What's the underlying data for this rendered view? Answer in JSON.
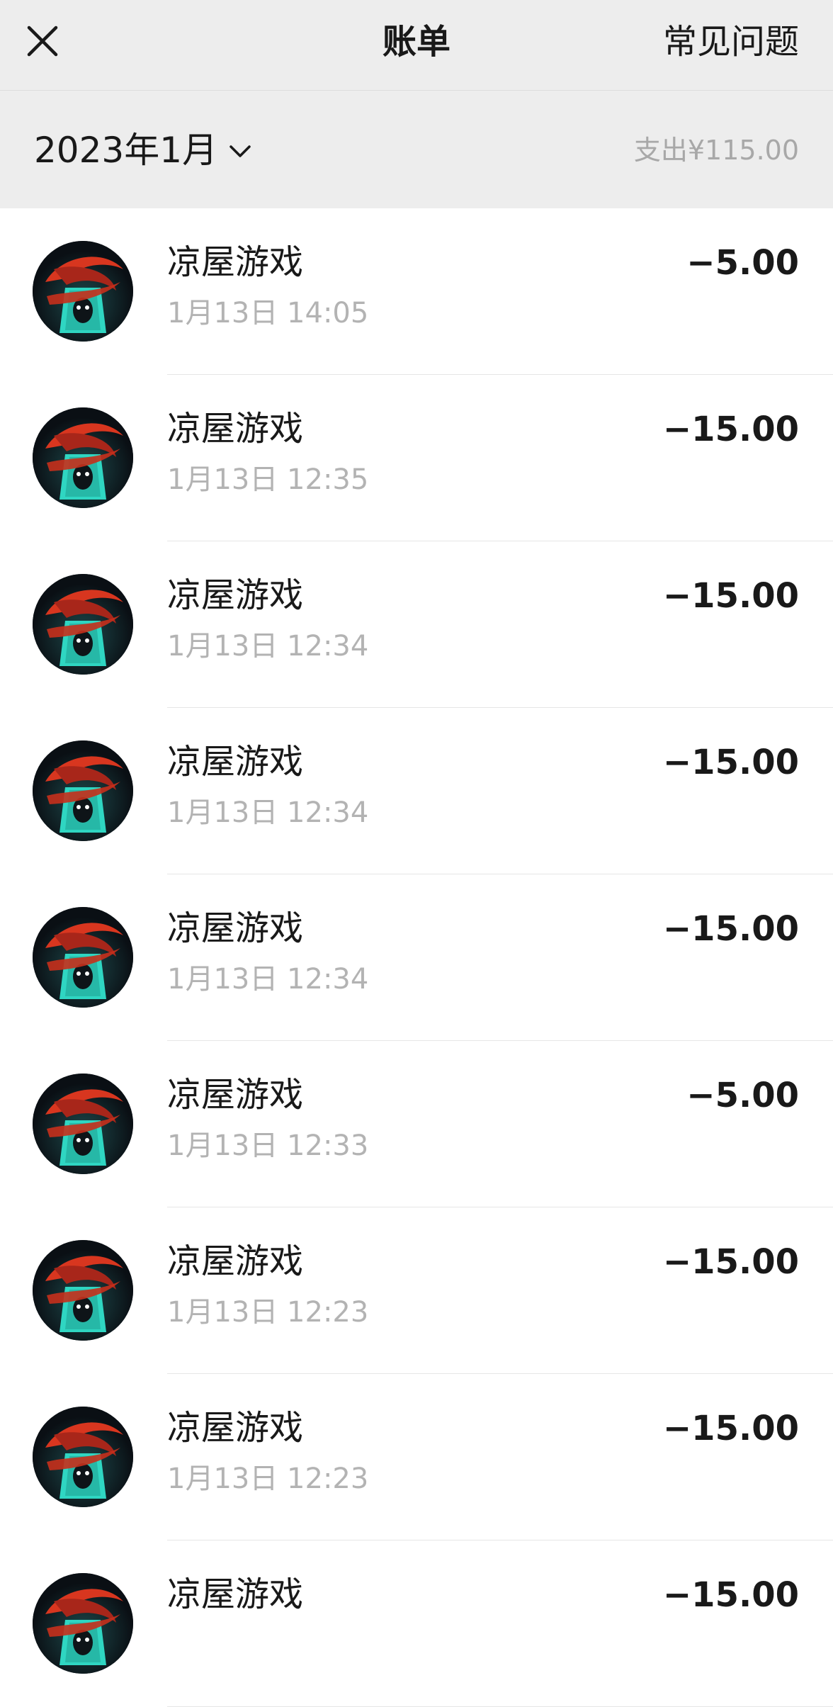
{
  "header": {
    "title": "账单",
    "faq_label": "常见问题",
    "close_icon": "close-icon"
  },
  "month_bar": {
    "month": "2023年1月",
    "dropdown_icon": "chevron-down-icon",
    "expense_label": "支出",
    "expense_amount": "¥115.00"
  },
  "transactions": [
    {
      "name": "凉屋游戏",
      "time": "1月13日 14:05",
      "amount": "−5.00"
    },
    {
      "name": "凉屋游戏",
      "time": "1月13日 12:35",
      "amount": "−15.00"
    },
    {
      "name": "凉屋游戏",
      "time": "1月13日 12:34",
      "amount": "−15.00"
    },
    {
      "name": "凉屋游戏",
      "time": "1月13日 12:34",
      "amount": "−15.00"
    },
    {
      "name": "凉屋游戏",
      "time": "1月13日 12:34",
      "amount": "−15.00"
    },
    {
      "name": "凉屋游戏",
      "time": "1月13日 12:33",
      "amount": "−5.00"
    },
    {
      "name": "凉屋游戏",
      "time": "1月13日 12:23",
      "amount": "−15.00"
    },
    {
      "name": "凉屋游戏",
      "time": "1月13日 12:23",
      "amount": "−15.00"
    },
    {
      "name": "凉屋游戏",
      "time": "",
      "amount": "−15.00"
    }
  ],
  "colors": {
    "header_bg": "#ededed",
    "text_primary": "#191919",
    "text_secondary": "#b3b3b3",
    "avatar_accent": "#2fd6c2",
    "avatar_ribbon": "#d8361f"
  }
}
